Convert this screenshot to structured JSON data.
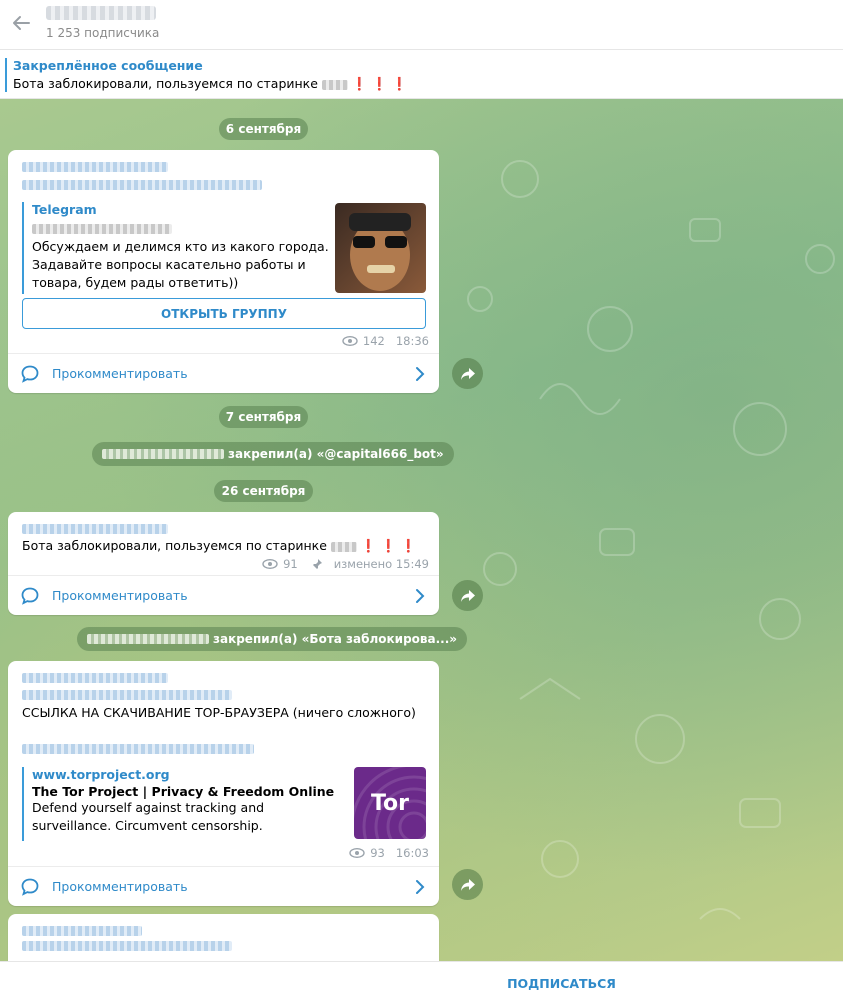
{
  "header": {
    "subscribers": "1 253 подписчика"
  },
  "pinned": {
    "title": "Закреплённое сообщение",
    "text": "Бота заблокировали, пользуемся по старинке",
    "suffix": "❗ ❗ ❗"
  },
  "dates": {
    "d1": "6 сентября",
    "d2": "7 сентября",
    "d3": "26 сентября"
  },
  "messages": {
    "m1": {
      "preview_site": "Telegram",
      "preview_desc": "Обсуждаем и делимся кто из какого города. Задавайте вопросы касательно работы и товара, будем рады ответить))",
      "button": "ОТКРЫТЬ ГРУППУ",
      "views": "142",
      "time": "18:36",
      "comment": "Прокомментировать"
    },
    "s1": {
      "text": "закрепил(а) «@capital666_bot»"
    },
    "m2": {
      "text": "Бота заблокировали, пользуемся по старинке",
      "suffix": "❗ ❗ ❗",
      "views": "91",
      "edited": "изменено 15:49",
      "comment": "Прокомментировать"
    },
    "s2": {
      "text": "закрепил(а) «Бота заблокирова...»"
    },
    "m3": {
      "text": "ССЫЛКА НА СКАЧИВАНИЕ ТОР-БРАУЗЕРА (ничего сложного)",
      "preview_site": "www.torproject.org",
      "preview_title": "The Tor Project | Privacy & Freedom Online",
      "preview_desc": "Defend yourself against tracking and surveillance. Circumvent censorship.",
      "thumb_text": "Tor",
      "views": "93",
      "time": "16:03",
      "comment": "Прокомментировать"
    }
  },
  "footer": {
    "subscribe": "ПОДПИСАТЬСЯ"
  },
  "colors": {
    "accent": "#2f8ac9",
    "tor_purple": "#6b2a8a"
  }
}
